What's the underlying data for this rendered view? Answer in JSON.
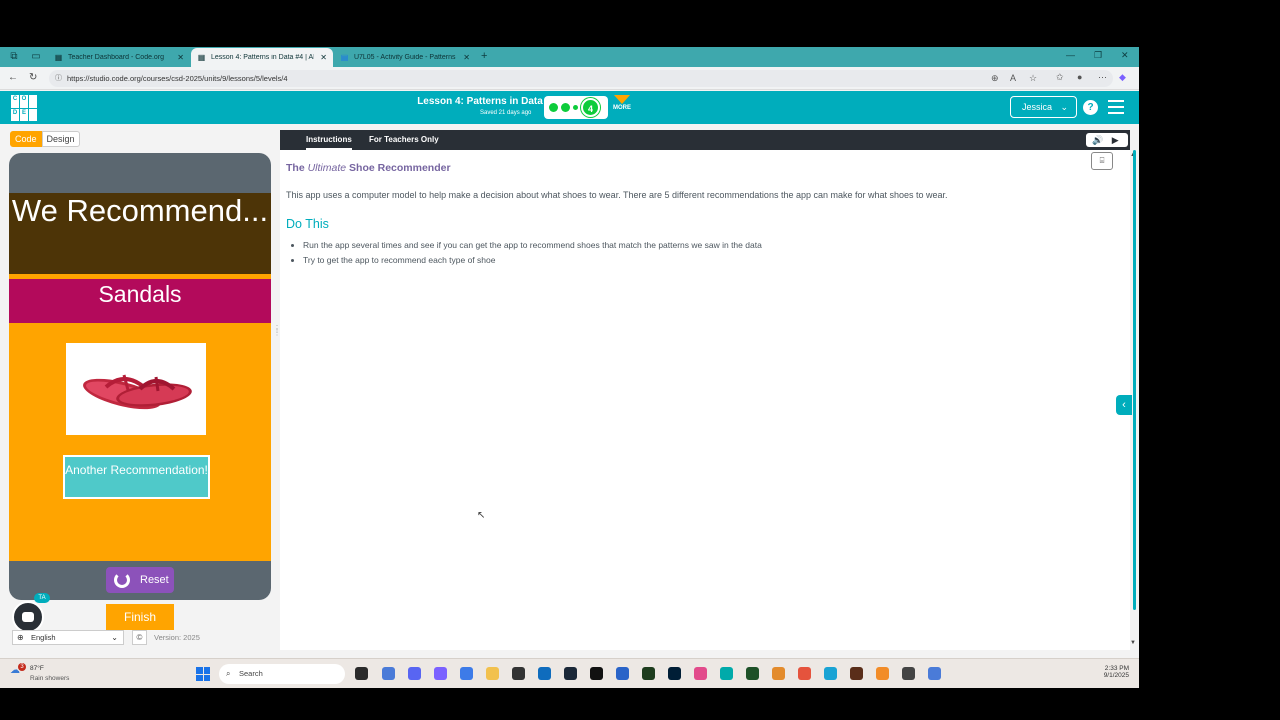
{
  "browser": {
    "tabs": [
      {
        "label": "Teacher Dashboard - Code.org",
        "active": false
      },
      {
        "label": "Lesson 4: Patterns in Data #4 | AI",
        "active": true
      },
      {
        "label": "U7L05 - Activity Guide - Patterns",
        "active": false
      }
    ],
    "url": "https://studio.code.org/courses/csd-2025/units/9/lessons/5/levels/4"
  },
  "header": {
    "lesson_title": "Lesson 4: Patterns in Data",
    "saved": "Saved 21 days ago",
    "current_level": "4",
    "more_label": "MORE",
    "user_name": "Jessica",
    "help_label": "?"
  },
  "mode": {
    "code_label": "Code",
    "design_label": "Design"
  },
  "app": {
    "heading": "We Recommend...",
    "recommendation": "Sandals",
    "another_label": "Another Recommendation!",
    "reset_label": "Reset",
    "finish_label": "Finish",
    "ta_badge": "TA",
    "language": "English",
    "version": "Version: 2025"
  },
  "instructions": {
    "tab_instructions": "Instructions",
    "tab_teachers": "For Teachers Only",
    "title_pre": "The ",
    "title_em": "Ultimate",
    "title_post": " Shoe Recommender",
    "description": "This app uses a computer model to help make a decision about what shoes to wear. There are 5 different recommendations the app can make for what shoes to wear.",
    "do_this": "Do This",
    "tasks": [
      "Run the app several times and see if you can get the app to recommend shoes that match the patterns we saw in the data",
      "Try to get the app to recommend each type of shoe"
    ]
  },
  "taskbar": {
    "weather_temp": "87°F",
    "weather_cond": "Rain showers",
    "weather_badge": "3",
    "search_label": "Search",
    "time": "2:33 PM",
    "date": "9/1/2025"
  },
  "colors": {
    "codeorg_teal": "#00adbc",
    "app_orange": "#ffa400",
    "heading_brown": "#4d3407",
    "recommend_magenta": "#b30a5b",
    "button_teal": "#4fc9c9",
    "reset_purple": "#8c52ba"
  }
}
